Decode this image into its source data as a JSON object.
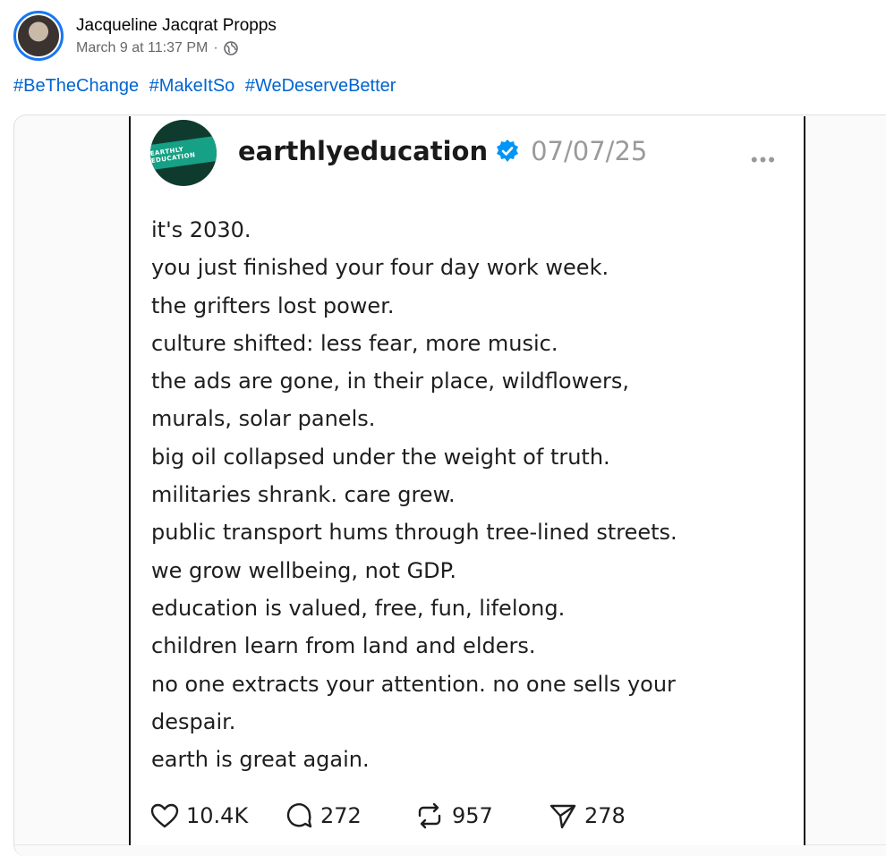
{
  "author": {
    "name": "Jacqueline Jacqrat Propps",
    "timestamp": "March 9 at 11:37 PM",
    "separator": "·",
    "audience_icon": "globe-icon"
  },
  "hashtags": [
    "#BeTheChange",
    "#MakeItSo",
    "#WeDeserveBetter"
  ],
  "embedded_post": {
    "username": "earthlyeducation",
    "date": "07/07/25",
    "verified_icon": "verified-badge-icon",
    "more_icon": "more-options-icon",
    "logo_text": "EARTHLY EDUCATION",
    "lines": [
      "it's 2030.",
      "you just finished your four day work week.",
      "the grifters lost power.",
      "culture shifted: less fear, more music.",
      "the ads are gone, in their place, wildflowers,",
      "murals, solar panels.",
      "big oil collapsed under the weight of truth.",
      "militaries shrank. care grew.",
      "public transport hums through tree-lined streets.",
      "we grow wellbeing, not GDP.",
      "education is valued, free, fun, lifelong.",
      "children learn from land and elders.",
      "no one extracts your attention. no one sells your",
      "despair.",
      "earth is great again."
    ],
    "stats": {
      "likes": "10.4K",
      "comments": "272",
      "reposts": "957",
      "shares": "278"
    }
  },
  "colors": {
    "hashtag": "#0064d1",
    "avatar_ring": "#1877f2",
    "verified": "#0095f6"
  }
}
